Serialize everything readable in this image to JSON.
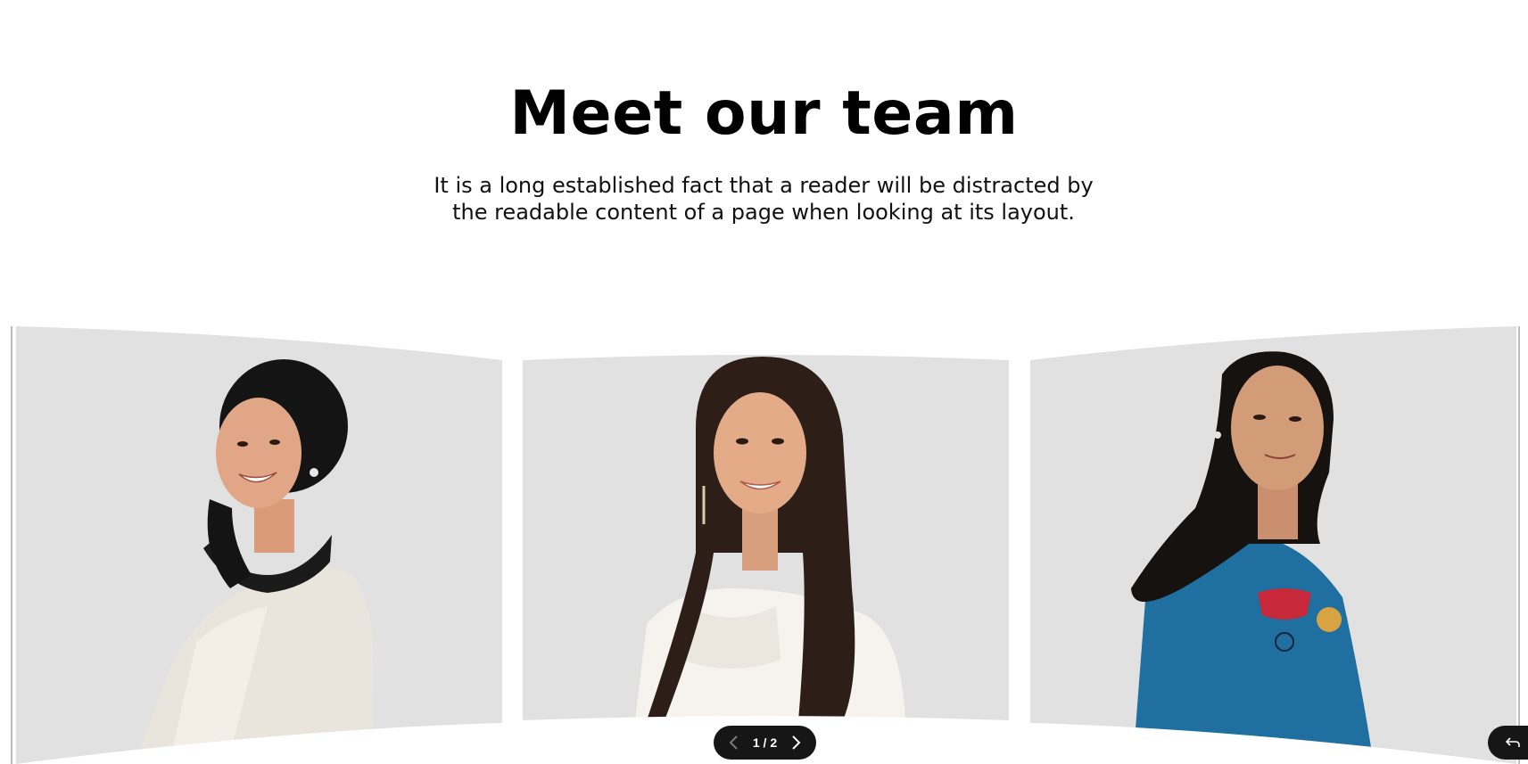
{
  "section": {
    "title": "Meet our team",
    "subtitle": "It is a long established fact that a reader will be distracted by the readable content of a page when looking at its layout."
  },
  "carousel": {
    "counter": "1 / 2",
    "current_page": 1,
    "total_pages": 2,
    "card_background": "#e1e1e1",
    "members": [
      {
        "id": "member-1",
        "shirt_color": "#e9e5dc",
        "hair_color": "#141414",
        "skin_color": "#e0a685"
      },
      {
        "id": "member-2",
        "shirt_color": "#f6f3ee",
        "hair_color": "#2d1f17",
        "skin_color": "#e3ab88"
      },
      {
        "id": "member-3",
        "shirt_color": "#1f6fa0",
        "hair_color": "#151210",
        "skin_color": "#d39c78"
      }
    ]
  },
  "icons": {
    "prev": "chevron-left-icon",
    "next": "chevron-right-icon",
    "corner": "undo-icon"
  },
  "colors": {
    "pill_bg": "#161616",
    "text": "#000000"
  }
}
